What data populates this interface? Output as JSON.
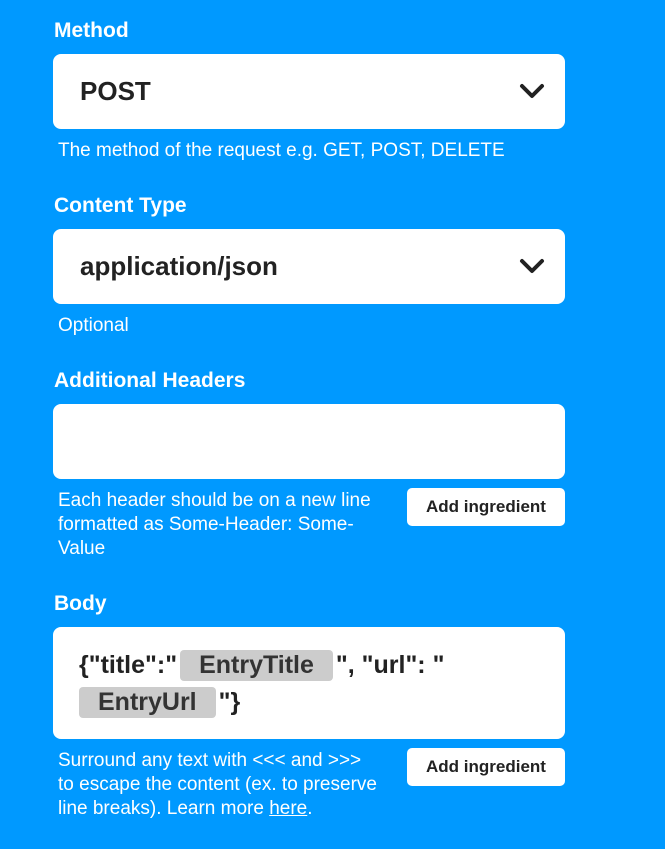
{
  "method": {
    "label": "Method",
    "value": "POST",
    "help": "The method of the request e.g. GET, POST, DELETE",
    "icon": "chevron-down-icon"
  },
  "content_type": {
    "label": "Content Type",
    "value": "application/json",
    "help": "Optional",
    "icon": "chevron-down-icon"
  },
  "headers": {
    "label": "Additional Headers",
    "value": "",
    "help": "Each header should be on a new line formatted as Some-Header: Some-Value",
    "add_ingredient": "Add ingredient"
  },
  "body": {
    "label": "Body",
    "text_1": "{\"title\":\"",
    "ingredient_1": "EntryTitle",
    "text_2": "\", \"url\": \"",
    "ingredient_2": "EntryUrl",
    "text_3": "\"}",
    "help_prefix": "Surround any text with <<< and >>> to escape the content (ex. to preserve line breaks). Learn more ",
    "help_link": "here",
    "help_suffix": ".",
    "add_ingredient": "Add ingredient"
  },
  "colors": {
    "background": "#0099ff",
    "field_bg": "#ffffff",
    "pill_bg": "#cccccc"
  }
}
